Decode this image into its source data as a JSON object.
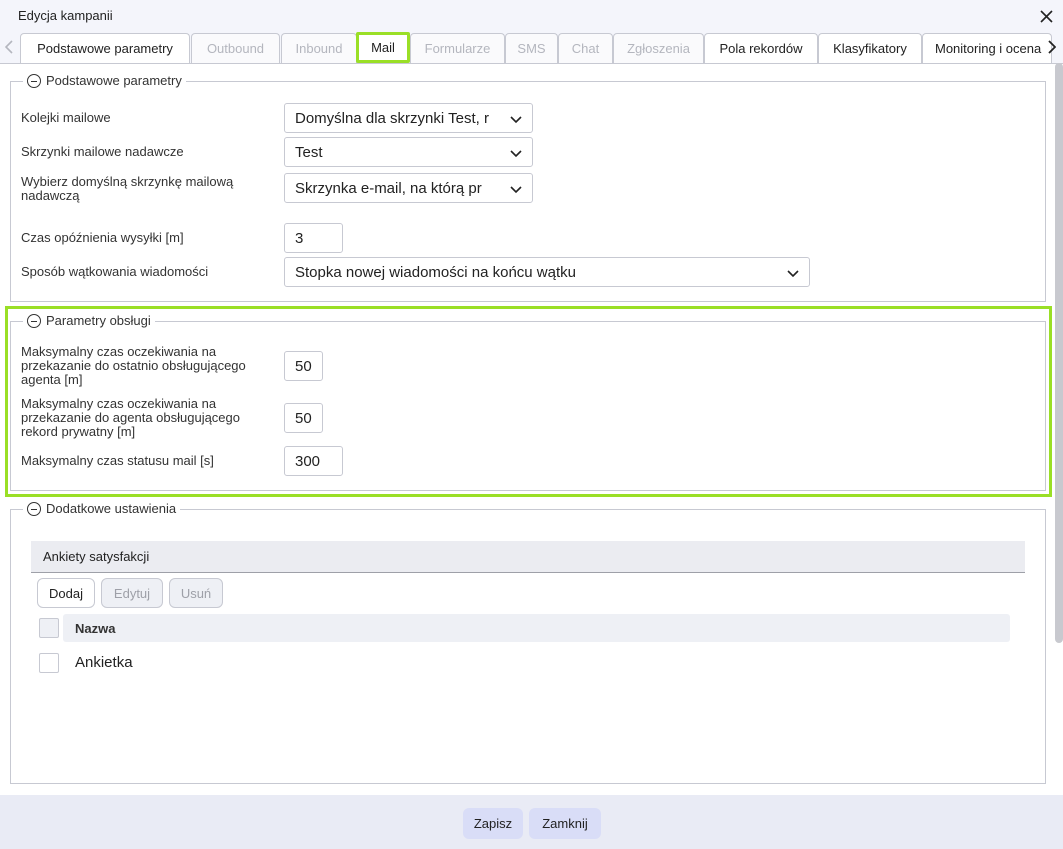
{
  "window": {
    "title": "Edycja kampanii"
  },
  "tabs": [
    {
      "label": "Podstawowe parametry",
      "state": "active"
    },
    {
      "label": "Outbound",
      "state": "disabled"
    },
    {
      "label": "Inbound",
      "state": "disabled"
    },
    {
      "label": "Mail",
      "state": "highlighted"
    },
    {
      "label": "Formularze",
      "state": "disabled"
    },
    {
      "label": "SMS",
      "state": "disabled"
    },
    {
      "label": "Chat",
      "state": "disabled"
    },
    {
      "label": "Zgłoszenia",
      "state": "disabled"
    },
    {
      "label": "Pola rekordów",
      "state": "active"
    },
    {
      "label": "Klasyfikatory",
      "state": "active"
    },
    {
      "label": "Monitoring i ocena",
      "state": "active"
    }
  ],
  "basic": {
    "legend": "Podstawowe parametry",
    "mail_queues": {
      "label": "Kolejki mailowe",
      "value": "Domyślna dla skrzynki Test, r"
    },
    "sender_boxes": {
      "label": "Skrzynki mailowe nadawcze",
      "value": "Test"
    },
    "default_box": {
      "label": "Wybierz domyślną skrzynkę mailową nadawczą",
      "value": "Skrzynka e-mail,  na którą pr"
    },
    "delay": {
      "label": "Czas opóźnienia wysyłki [m]",
      "value": "3"
    },
    "threading": {
      "label": "Sposób wątkowania wiadomości",
      "value": "Stopka nowej wiadomości na końcu wątku"
    }
  },
  "handling": {
    "legend": "Parametry obsługi",
    "wait_last_agent": {
      "label": "Maksymalny czas oczekiwania na przekazanie do ostatnio obsługującego agenta [m]",
      "value": "50"
    },
    "wait_private": {
      "label": "Maksymalny czas oczekiwania na przekazanie do agenta obsługującego rekord prywatny [m]",
      "value": "50"
    },
    "mail_status": {
      "label": "Maksymalny czas statusu mail [s]",
      "value": "300"
    }
  },
  "extra": {
    "legend": "Dodatkowe ustawienia",
    "surveys_header": "Ankiety satysfakcji",
    "add": "Dodaj",
    "edit": "Edytuj",
    "delete": "Usuń",
    "column_name": "Nazwa",
    "rows": [
      "Ankietka"
    ]
  },
  "footer": {
    "save": "Zapisz",
    "close": "Zamknij"
  },
  "colors": {
    "highlight": "#9adf26",
    "footer_button": "#d9ddf7"
  }
}
